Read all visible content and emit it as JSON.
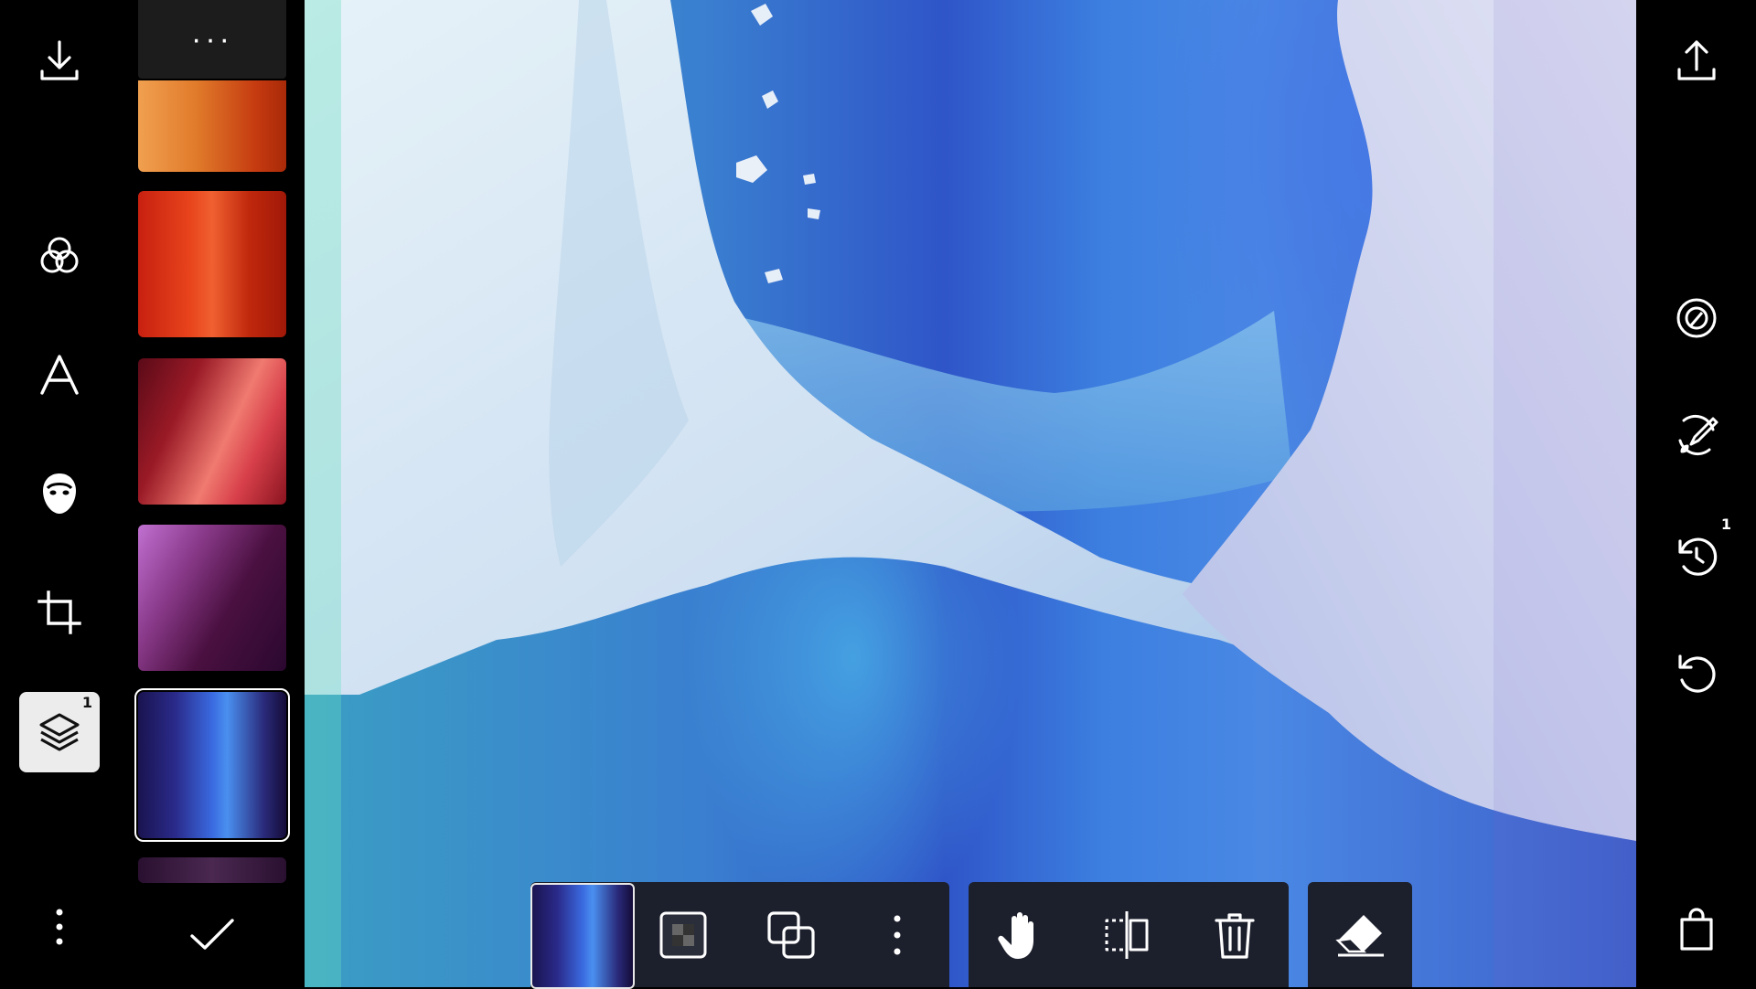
{
  "left_rail": {
    "items": [
      {
        "name": "download",
        "icon": "download-icon"
      },
      {
        "name": "filters",
        "icon": "filters-icon"
      },
      {
        "name": "text",
        "icon": "text-icon"
      },
      {
        "name": "face",
        "icon": "face-icon"
      },
      {
        "name": "crop",
        "icon": "crop-icon"
      },
      {
        "name": "layers",
        "icon": "layers-icon",
        "badge": "1",
        "active": true
      },
      {
        "name": "more",
        "icon": "more-vertical-icon"
      }
    ]
  },
  "thumbnails": {
    "more_label": "···",
    "items": [
      {
        "name": "orange-gradient"
      },
      {
        "name": "red-gradient"
      },
      {
        "name": "crimson-gradient"
      },
      {
        "name": "purple-gradient"
      },
      {
        "name": "blue-light-leak",
        "selected": true
      },
      {
        "name": "partial-next"
      }
    ],
    "confirm_icon": "checkmark-icon"
  },
  "right_rail": {
    "items": [
      {
        "name": "export",
        "icon": "share-upload-icon"
      },
      {
        "name": "looks",
        "icon": "looks-icon"
      },
      {
        "name": "heal",
        "icon": "heal-brush-icon"
      },
      {
        "name": "history",
        "icon": "history-icon",
        "badge": "1"
      },
      {
        "name": "revert",
        "icon": "revert-icon"
      },
      {
        "name": "shop",
        "icon": "shopping-bag-icon"
      }
    ]
  },
  "toolbar": {
    "buttons": [
      {
        "name": "opacity",
        "icon": "transparency-checker-icon"
      },
      {
        "name": "blend",
        "icon": "blend-mode-icon"
      },
      {
        "name": "more",
        "icon": "more-vertical-icon"
      },
      {
        "name": "move",
        "icon": "hand-icon"
      },
      {
        "name": "flip",
        "icon": "flip-icon"
      },
      {
        "name": "delete",
        "icon": "trash-icon"
      },
      {
        "name": "erase",
        "icon": "eraser-icon"
      }
    ]
  },
  "colors": {
    "background": "#000000",
    "toolbar": "#1c1f2c",
    "active_tool": "#ececec"
  }
}
